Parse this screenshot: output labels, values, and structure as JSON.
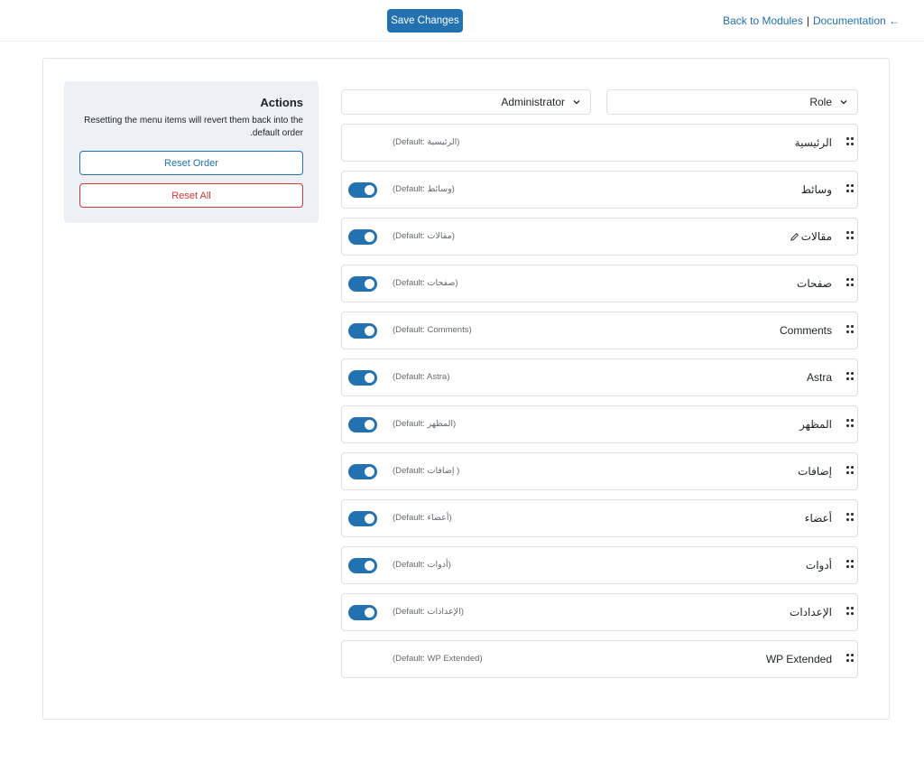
{
  "header": {
    "save_label": "Save Changes",
    "back_label": "Back to Modules",
    "separator": "|",
    "docs_label": "Documentation ←"
  },
  "actions": {
    "title": "Actions",
    "description": "Resetting the menu items will revert them back into the default order.",
    "reset_order_label": "Reset Order",
    "reset_all_label": "Reset All"
  },
  "filters": {
    "role_label": "Role",
    "role_value": "Administrator"
  },
  "colors": {
    "accent": "#2271b1",
    "danger": "#d63638"
  },
  "menu_items": [
    {
      "label": "الرئيسية",
      "default": "(Default: الرئيسية)",
      "toggle": false,
      "enabled": true
    },
    {
      "label": "وسائط",
      "default": "(Default: وسائط)",
      "toggle": true,
      "enabled": true
    },
    {
      "label": "مقالات",
      "default": "(Default: مقالات)",
      "toggle": true,
      "enabled": true,
      "icon": "pencil-icon"
    },
    {
      "label": "صفحات",
      "default": "(Default: صفحات)",
      "toggle": true,
      "enabled": true
    },
    {
      "label": "Comments",
      "default": "(Default: Comments)",
      "toggle": true,
      "enabled": true
    },
    {
      "label": "Astra",
      "default": "(Default: Astra)",
      "toggle": true,
      "enabled": true
    },
    {
      "label": "المظهر",
      "default": "(Default: المظهر)",
      "toggle": true,
      "enabled": true
    },
    {
      "label": "إضافات",
      "default": "(Default: إضافات )",
      "toggle": true,
      "enabled": true
    },
    {
      "label": "أعضاء",
      "default": "(Default: أعضاء)",
      "toggle": true,
      "enabled": true
    },
    {
      "label": "أدوات",
      "default": "(Default: أدوات)",
      "toggle": true,
      "enabled": true
    },
    {
      "label": "الإعدادات",
      "default": "(Default: الإعدادات)",
      "toggle": true,
      "enabled": true
    },
    {
      "label": "WP Extended",
      "default": "(Default: WP Extended)",
      "toggle": false,
      "enabled": true
    }
  ]
}
